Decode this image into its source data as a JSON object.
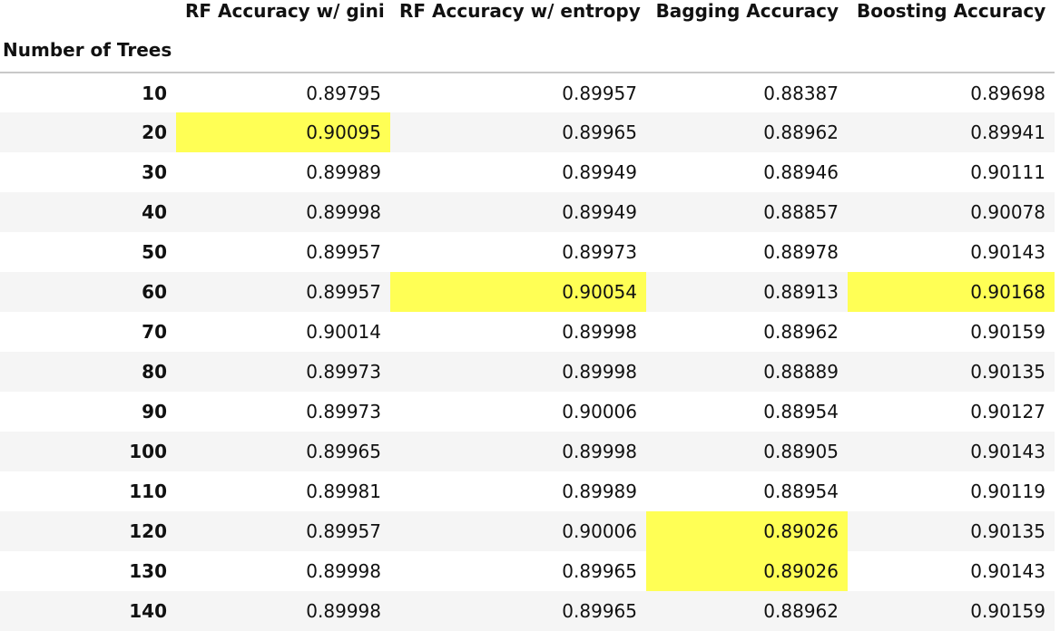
{
  "table": {
    "columns": [
      "RF Accuracy w/ gini",
      "RF Accuracy w/ entropy",
      "Bagging Accuracy",
      "Boosting Accuracy"
    ],
    "index_name": "Number of Trees",
    "highlight_color": "#ffff55",
    "rows": [
      {
        "index": "10",
        "values": [
          "0.89795",
          "0.89957",
          "0.88387",
          "0.89698"
        ],
        "highlight": [
          false,
          false,
          false,
          false
        ]
      },
      {
        "index": "20",
        "values": [
          "0.90095",
          "0.89965",
          "0.88962",
          "0.89941"
        ],
        "highlight": [
          true,
          false,
          false,
          false
        ]
      },
      {
        "index": "30",
        "values": [
          "0.89989",
          "0.89949",
          "0.88946",
          "0.90111"
        ],
        "highlight": [
          false,
          false,
          false,
          false
        ]
      },
      {
        "index": "40",
        "values": [
          "0.89998",
          "0.89949",
          "0.88857",
          "0.90078"
        ],
        "highlight": [
          false,
          false,
          false,
          false
        ]
      },
      {
        "index": "50",
        "values": [
          "0.89957",
          "0.89973",
          "0.88978",
          "0.90143"
        ],
        "highlight": [
          false,
          false,
          false,
          false
        ]
      },
      {
        "index": "60",
        "values": [
          "0.89957",
          "0.90054",
          "0.88913",
          "0.90168"
        ],
        "highlight": [
          false,
          true,
          false,
          true
        ]
      },
      {
        "index": "70",
        "values": [
          "0.90014",
          "0.89998",
          "0.88962",
          "0.90159"
        ],
        "highlight": [
          false,
          false,
          false,
          false
        ]
      },
      {
        "index": "80",
        "values": [
          "0.89973",
          "0.89998",
          "0.88889",
          "0.90135"
        ],
        "highlight": [
          false,
          false,
          false,
          false
        ]
      },
      {
        "index": "90",
        "values": [
          "0.89973",
          "0.90006",
          "0.88954",
          "0.90127"
        ],
        "highlight": [
          false,
          false,
          false,
          false
        ]
      },
      {
        "index": "100",
        "values": [
          "0.89965",
          "0.89998",
          "0.88905",
          "0.90143"
        ],
        "highlight": [
          false,
          false,
          false,
          false
        ]
      },
      {
        "index": "110",
        "values": [
          "0.89981",
          "0.89989",
          "0.88954",
          "0.90119"
        ],
        "highlight": [
          false,
          false,
          false,
          false
        ]
      },
      {
        "index": "120",
        "values": [
          "0.89957",
          "0.90006",
          "0.89026",
          "0.90135"
        ],
        "highlight": [
          false,
          false,
          true,
          false
        ]
      },
      {
        "index": "130",
        "values": [
          "0.89998",
          "0.89965",
          "0.89026",
          "0.90143"
        ],
        "highlight": [
          false,
          false,
          true,
          false
        ]
      },
      {
        "index": "140",
        "values": [
          "0.89998",
          "0.89965",
          "0.88962",
          "0.90159"
        ],
        "highlight": [
          false,
          false,
          false,
          false
        ]
      }
    ]
  }
}
